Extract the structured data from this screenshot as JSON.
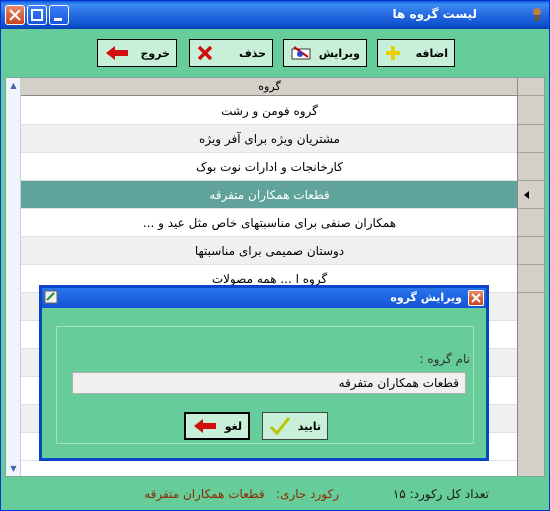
{
  "window": {
    "title": "لیست گروه ها"
  },
  "toolbar": {
    "add_label": "اضافه",
    "edit_label": "ویرایش",
    "delete_label": "حذف",
    "exit_label": "خروج"
  },
  "grid": {
    "header": "گروه",
    "rows": [
      "گروه فومن و رشت",
      "مشتریان ویژه برای آفر ویژه",
      "کارخانجات و ادارات نوت بوک",
      "قطعات همکاران متفرقه",
      "همکاران صنفی برای مناسبتهای خاص مثل عید و ...",
      "دوستان صمیمی برای مناسبتها",
      "گروه ا ... همه مصولات"
    ],
    "selected_index": 3
  },
  "status": {
    "total_text": "تعداد کل رکورد: ۱۵",
    "current_label": "رکورد جاری:",
    "current_value": "قطعات همکاران متفرقه"
  },
  "dialog": {
    "title": "ویرایش گروه",
    "field_label": "نام گروه :",
    "field_value": "قطعات همکاران متفرقه",
    "confirm_label": "تایید",
    "cancel_label": "لغو"
  },
  "colors": {
    "window_bg": "#66cc99",
    "selected_row": "#5fa39a",
    "titlebar": "#1254d4"
  }
}
